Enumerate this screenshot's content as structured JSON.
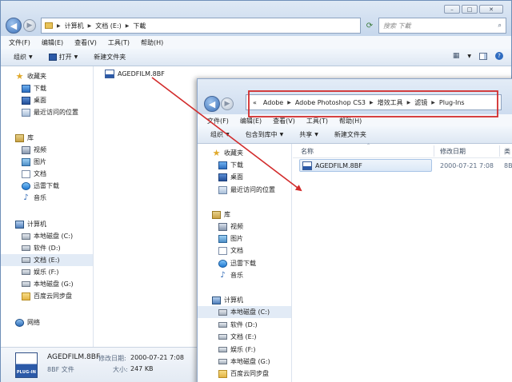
{
  "window_back": {
    "breadcrumb": [
      "计算机",
      "文档 (E:)",
      "下載"
    ],
    "search_placeholder": "搜索 下載",
    "menu": [
      "文件(F)",
      "编辑(E)",
      "查看(V)",
      "工具(T)",
      "帮助(H)"
    ],
    "toolbar": {
      "organize": "组织",
      "open": "打开",
      "new_folder": "新建文件夹"
    },
    "favorites_header": "收藏夹",
    "favorites": [
      "下载",
      "桌面",
      "最近访问的位置"
    ],
    "libraries_header": "库",
    "libraries": [
      "视频",
      "图片",
      "文档",
      "迅雷下载",
      "音乐"
    ],
    "computer_header": "计算机",
    "drives": [
      "本地磁盘 (C:)",
      "软件 (D:)",
      "文档 (E:)",
      "娱乐 (F:)",
      "本地磁盘 (G:)",
      "百度云同步盘"
    ],
    "network": "网络",
    "file": "AGEDFILM.8BF",
    "details": {
      "name": "AGEDFILM.8BF",
      "modified_label": "修改日期:",
      "modified_value": "2000-07-21 7:08",
      "type": "8BF 文件",
      "size_label": "大小:",
      "size_value": "247 KB",
      "icon_label": "PLUG-IN"
    }
  },
  "window_front": {
    "breadcrumb_prefix": "«",
    "breadcrumb": [
      "Adobe",
      "Adobe Photoshop CS3",
      "增效工具",
      "滤镜",
      "Plug-Ins"
    ],
    "menu": [
      "文件(F)",
      "编辑(E)",
      "查看(V)",
      "工具(T)",
      "帮助(H)"
    ],
    "toolbar": {
      "organize": "组织",
      "include_library": "包含到库中",
      "share": "共享",
      "new_folder": "新建文件夹"
    },
    "favorites_header": "收藏夹",
    "favorites": [
      "下载",
      "桌面",
      "最近访问的位置"
    ],
    "libraries_header": "库",
    "libraries": [
      "视频",
      "图片",
      "文档",
      "迅雷下载",
      "音乐"
    ],
    "computer_header": "计算机",
    "drives": [
      "本地磁盘 (C:)",
      "软件 (D:)",
      "文档 (E:)",
      "娱乐 (F:)",
      "本地磁盘 (G:)",
      "百度云同步盘"
    ],
    "columns": {
      "name": "名称",
      "date": "修改日期",
      "type": "类"
    },
    "file": {
      "name": "AGEDFILM.8BF",
      "date": "2000-07-21 7:08",
      "type": "8B"
    }
  },
  "colors": {
    "annotation": "#d22b2b",
    "titlebar": "#c6d7ec",
    "selection": "#e2ebf6"
  }
}
